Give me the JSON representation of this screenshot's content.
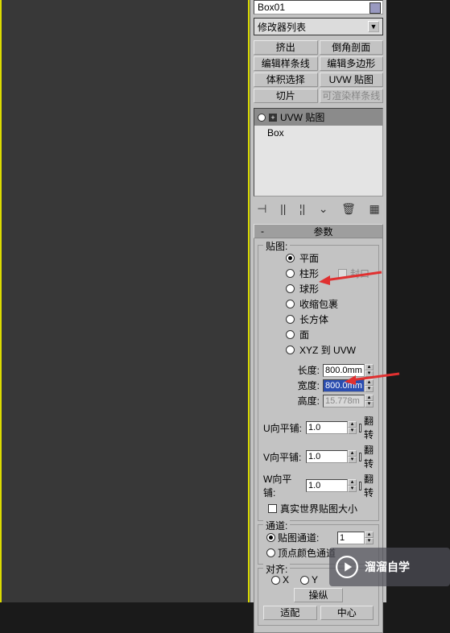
{
  "object_name": "Box01",
  "modifier_dropdown": "修改器列表",
  "buttons": {
    "extrude": "挤出",
    "chamfer": "倒角剖面",
    "edit_spline": "编辑样条线",
    "edit_poly": "编辑多边形",
    "vol_select": "体积选择",
    "uvw_map": "UVW 贴图",
    "slice": "切片",
    "renderable_spline": "可渲染样条线"
  },
  "stack": {
    "active": "UVW 贴图",
    "base": "Box"
  },
  "rollout": {
    "title": "参数",
    "mapping_group": "贴图:",
    "mapping": {
      "planar": "平面",
      "cylindrical": "柱形",
      "cap": "封口",
      "spherical": "球形",
      "shrink": "收缩包裹",
      "box": "长方体",
      "face": "面",
      "xyz": "XYZ 到 UVW"
    },
    "dims": {
      "length_label": "长度:",
      "length_value": "800.0mm",
      "width_label": "宽度:",
      "width_value": "800.0mm",
      "height_label": "高度:",
      "height_value": "15.778m"
    },
    "tile": {
      "u_label": "U向平铺:",
      "u_val": "1.0",
      "v_label": "V向平铺:",
      "v_val": "1.0",
      "w_label": "W向平铺:",
      "w_val": "1.0",
      "flip": "翻转"
    },
    "realworld": "真实世界贴图大小",
    "channel_group": "通道:",
    "channel": {
      "map_channel": "贴图通道:",
      "map_val": "1",
      "vertex_color": "顶点颜色通道"
    },
    "align_group": "对齐:",
    "align": {
      "x": "X",
      "y": "Y",
      "manipulate": "操纵",
      "fit": "适配",
      "center": "中心"
    }
  },
  "watermark": "溜溜自学"
}
